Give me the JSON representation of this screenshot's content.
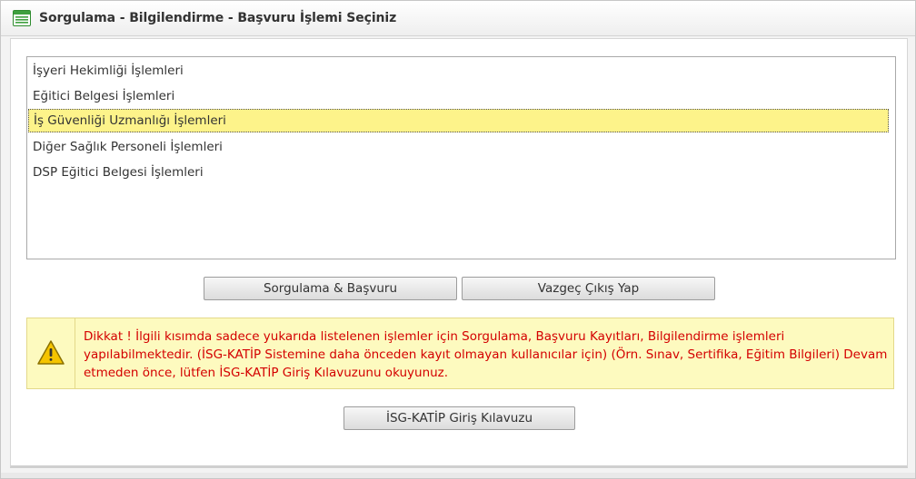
{
  "window": {
    "title": "Sorgulama - Bilgilendirme - Başvuru İşlemi Seçiniz",
    "icon": "form-list-icon"
  },
  "operations_list": {
    "items": [
      {
        "label": "İşyeri Hekimliği İşlemleri",
        "selected": false
      },
      {
        "label": "Eğitici Belgesi İşlemleri",
        "selected": false
      },
      {
        "label": "İş Güvenliği Uzmanlığı İşlemleri",
        "selected": true
      },
      {
        "label": "Diğer Sağlık Personeli İşlemleri",
        "selected": false
      },
      {
        "label": "DSP Eğitici Belgesi İşlemleri",
        "selected": false
      }
    ]
  },
  "buttons": {
    "query_apply": "Sorgulama & Başvuru",
    "cancel_exit": "Vazgeç Çıkış Yap",
    "guide": "İSG-KATİP Giriş Kılavuzu"
  },
  "warning": {
    "icon": "warning-icon",
    "text": "Dikkat ! İlgili kısımda sadece yukarıda listelenen işlemler için Sorgulama, Başvuru Kayıtları, Bilgilendirme işlemleri yapılabilmektedir. (İSG-KATİP Sistemine daha önceden kayıt olmayan kullanıcılar için) (Örn. Sınav, Sertifika, Eğitim Bilgileri) Devam etmeden önce, lütfen İSG-KATİP Giriş Kılavuzunu okuyunuz."
  },
  "colors": {
    "selected_row": "#fdf38a",
    "warning_background": "#fdfabf",
    "warning_text": "#d40000"
  }
}
